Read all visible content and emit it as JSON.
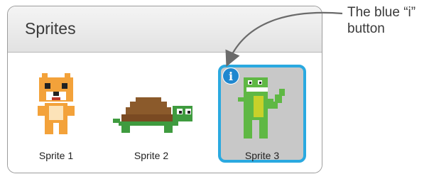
{
  "panel": {
    "title": "Sprites"
  },
  "sprites": [
    {
      "label": "Sprite 1",
      "icon": "cat-sprite-icon"
    },
    {
      "label": "Sprite 2",
      "icon": "turtle-sprite-icon"
    },
    {
      "label": "Sprite 3",
      "icon": "dinosaur-sprite-icon",
      "selected": true
    }
  ],
  "info_button": {
    "glyph": "i",
    "color": "#1f87cf"
  },
  "selection_color": "#2aa9e0",
  "callout": {
    "text": "The blue “i” button"
  }
}
